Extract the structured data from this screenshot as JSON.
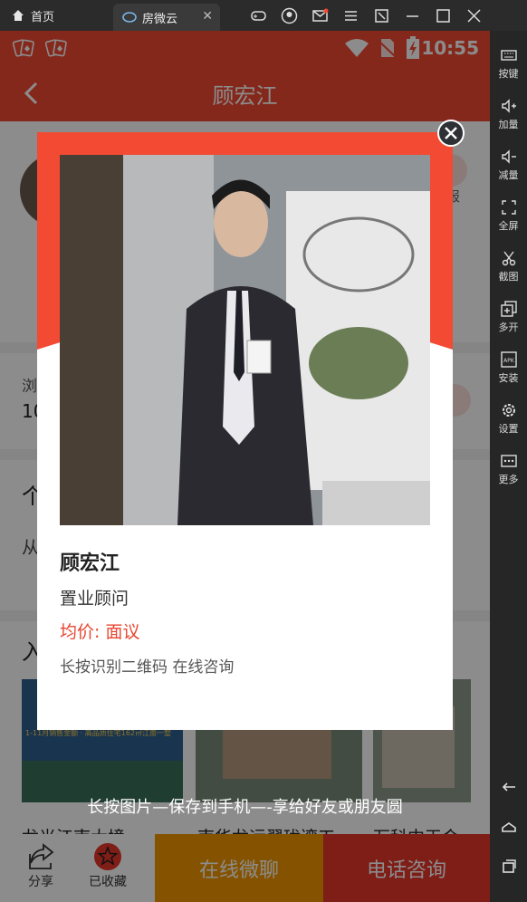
{
  "emulator": {
    "home_tab": "首页",
    "app_tab": "房微云",
    "sidebar": [
      {
        "label": "按键",
        "icon": "keyboard-icon"
      },
      {
        "label": "加量",
        "icon": "volume-up-icon"
      },
      {
        "label": "减量",
        "icon": "volume-down-icon"
      },
      {
        "label": "全屏",
        "icon": "fullscreen-icon"
      },
      {
        "label": "截图",
        "icon": "scissors-icon"
      },
      {
        "label": "多开",
        "icon": "multi-open-icon"
      },
      {
        "label": "安装",
        "icon": "apk-icon"
      },
      {
        "label": "设置",
        "icon": "gear-icon"
      },
      {
        "label": "更多",
        "icon": "more-icon"
      }
    ]
  },
  "status_bar": {
    "time": "10:55"
  },
  "app_bar": {
    "title": "顾宏江"
  },
  "background": {
    "report_label": "举报",
    "views_label_fragment": "浏",
    "views_value_fragment": "10",
    "intro_heading_fragment": "个",
    "intro_text_fragment": "从",
    "projects_heading_fragment": "入",
    "project_names": [
      "龙光江南大境",
      "南华龙运翠珑湾工",
      "万科中天会"
    ],
    "banner_text": "1-11月销售金额 · 高品质住宅162㎡江南一墅"
  },
  "popup": {
    "name": "顾宏江",
    "role": "置业顾问",
    "price": "均价: 面议",
    "qr_hint": "长按识别二维码 在线咨询",
    "save_tip": "长按图片—保存到手机—-享给好友或朋友圆"
  },
  "bottom_bar": {
    "share": "分享",
    "favorite": "已收藏",
    "chat": "在线微聊",
    "call": "电话咨询"
  },
  "colors": {
    "brand_red": "#f24a33",
    "chat_orange": "#f39800",
    "call_red": "#e8352a"
  }
}
